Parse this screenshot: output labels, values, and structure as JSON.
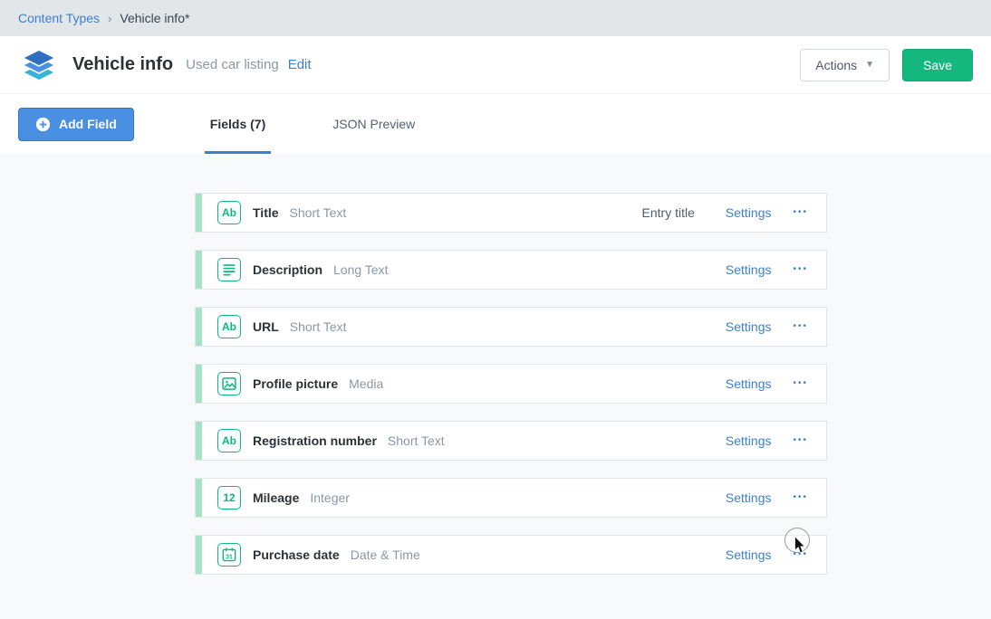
{
  "breadcrumb": {
    "content_types": "Content Types",
    "separator": "›",
    "current": "Vehicle info*"
  },
  "header": {
    "title": "Vehicle info",
    "subtitle": "Used car listing",
    "edit_label": "Edit",
    "actions_label": "Actions",
    "save_label": "Save"
  },
  "toolbar": {
    "add_field_label": "Add Field"
  },
  "tabs": {
    "fields": "Fields (7)",
    "json_preview": "JSON Preview"
  },
  "icons": {
    "short_text_glyph": "Ab",
    "integer_glyph": "12",
    "date_glyph": "31"
  },
  "labels": {
    "settings": "Settings",
    "more_glyph": "•••"
  },
  "fields": [
    {
      "icon": "short-text-icon",
      "name": "Title",
      "type": "Short Text",
      "badge": "Entry title"
    },
    {
      "icon": "long-text-icon",
      "name": "Description",
      "type": "Long Text",
      "badge": ""
    },
    {
      "icon": "short-text-icon",
      "name": "URL",
      "type": "Short Text",
      "badge": ""
    },
    {
      "icon": "media-icon",
      "name": "Profile picture",
      "type": "Media",
      "badge": ""
    },
    {
      "icon": "short-text-icon",
      "name": "Registration number",
      "type": "Short Text",
      "badge": ""
    },
    {
      "icon": "integer-icon",
      "name": "Mileage",
      "type": "Integer",
      "badge": ""
    },
    {
      "icon": "date-icon",
      "name": "Purchase date",
      "type": "Date & Time",
      "badge": ""
    }
  ],
  "colors": {
    "link_blue": "#3c80cf",
    "button_blue": "#4a90e2",
    "save_green": "#14b87f",
    "field_icon_green": "#0eb87f",
    "row_accent_green": "#a6e2c6",
    "breadcrumb_bg": "#e3e6e8",
    "page_bg": "#f7f9fa"
  }
}
